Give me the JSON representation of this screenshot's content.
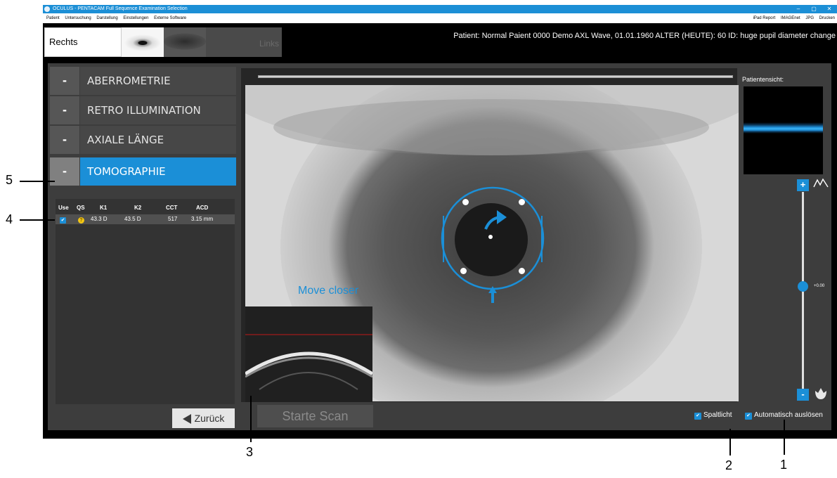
{
  "window": {
    "title": "OCULUS - PENTACAM Full Sequence Examination Selection",
    "controls": [
      "–",
      "▢",
      "✕"
    ]
  },
  "menubar": {
    "left_items": [
      "Patient",
      "Untersuchung",
      "Darstellung",
      "Einstellungen",
      "Externe Software"
    ],
    "right_items": [
      "iPad Report",
      "IMAGEnet",
      "JPG",
      "Drucken"
    ]
  },
  "eye_tabs": {
    "right_label": "Rechts",
    "left_label": "Links"
  },
  "patient_info": "Patient: Normal Paient 0000 Demo AXL Wave, 01.01.1960   ALTER (HEUTE): 60   ID: huge pupil diameter change",
  "modules": [
    {
      "minus": "-",
      "label": "ABERROMETRIE",
      "active": false
    },
    {
      "minus": "-",
      "label": "RETRO ILLUMINATION",
      "active": false
    },
    {
      "minus": "-",
      "label": "AXIALE LÄNGE",
      "active": false
    },
    {
      "minus": "-",
      "label": "TOMOGRAPHIE",
      "active": true
    }
  ],
  "table": {
    "headers": [
      "Use",
      "QS",
      "K1",
      "K2",
      "CCT",
      "ACD"
    ],
    "rows": [
      {
        "use": "✔",
        "qs": "?",
        "k1": "43.3 D",
        "k2": "43.5 D",
        "cct": "517",
        "acd": "3.15 mm"
      }
    ]
  },
  "back_button": "Zurück",
  "start_button": "Starte Scan",
  "camera": {
    "hint": "Move closer"
  },
  "patient_view_label": "Patientensicht:",
  "zoom": {
    "plus": "+",
    "minus": "-",
    "value": "+0.00",
    "slider_fraction": 0.52
  },
  "checkboxes": [
    {
      "label": "Spaltlicht",
      "checked": true
    },
    {
      "label": "Automatisch auslösen",
      "checked": true
    }
  ],
  "callouts": [
    "1",
    "2",
    "3",
    "4",
    "5"
  ],
  "colors": {
    "accent": "#1b8fd7",
    "titlebar": "#1c8fd6",
    "panel": "#3d3d3d",
    "qs_warning": "#f2c513"
  },
  "icons": {
    "title": "pentacam-logo-icon",
    "focus": "mountain-icon",
    "macro": "flower-icon",
    "back": "triangle-left-icon",
    "target": "focus-arrow-icon"
  }
}
